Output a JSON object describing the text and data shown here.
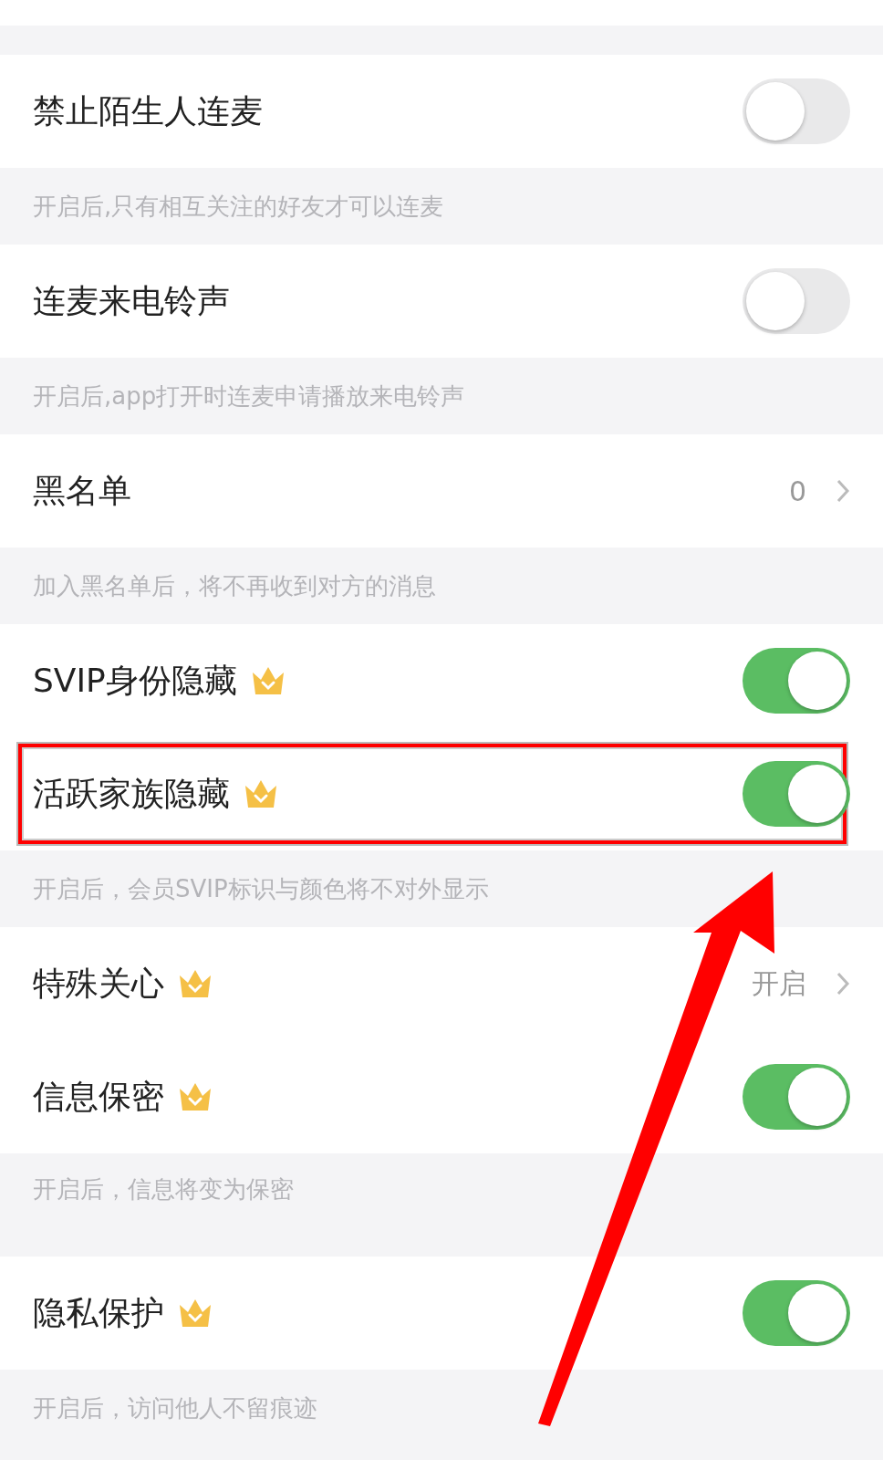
{
  "settings": [
    {
      "kind": "toggle",
      "label": "禁止陌生人连麦",
      "crown": false,
      "on": false,
      "highlighted": false
    },
    {
      "kind": "note",
      "text": "开启后,只有相互关注的好友才可以连麦"
    },
    {
      "kind": "toggle",
      "label": "连麦来电铃声",
      "crown": false,
      "on": false,
      "highlighted": false
    },
    {
      "kind": "note",
      "text": "开启后,app打开时连麦申请播放来电铃声"
    },
    {
      "kind": "link",
      "label": "黑名单",
      "crown": false,
      "value": "0"
    },
    {
      "kind": "note",
      "text": "加入黑名单后，将不再收到对方的消息"
    },
    {
      "kind": "toggle",
      "label": "SVIP身份隐藏",
      "crown": true,
      "on": true,
      "highlighted": false
    },
    {
      "kind": "toggle",
      "label": "活跃家族隐藏",
      "crown": true,
      "on": true,
      "highlighted": true
    },
    {
      "kind": "note",
      "text": "开启后，会员SVIP标识与颜色将不对外显示"
    },
    {
      "kind": "link",
      "label": "特殊关心",
      "crown": true,
      "value": "开启"
    },
    {
      "kind": "toggle",
      "label": "信息保密",
      "crown": true,
      "on": true,
      "highlighted": false
    },
    {
      "kind": "note",
      "text": "开启后，信息将变为保密",
      "tall": true
    },
    {
      "kind": "toggle",
      "label": "隐私保护",
      "crown": true,
      "on": true,
      "highlighted": false
    },
    {
      "kind": "note",
      "text": "开启后，访问他人不留痕迹"
    }
  ]
}
